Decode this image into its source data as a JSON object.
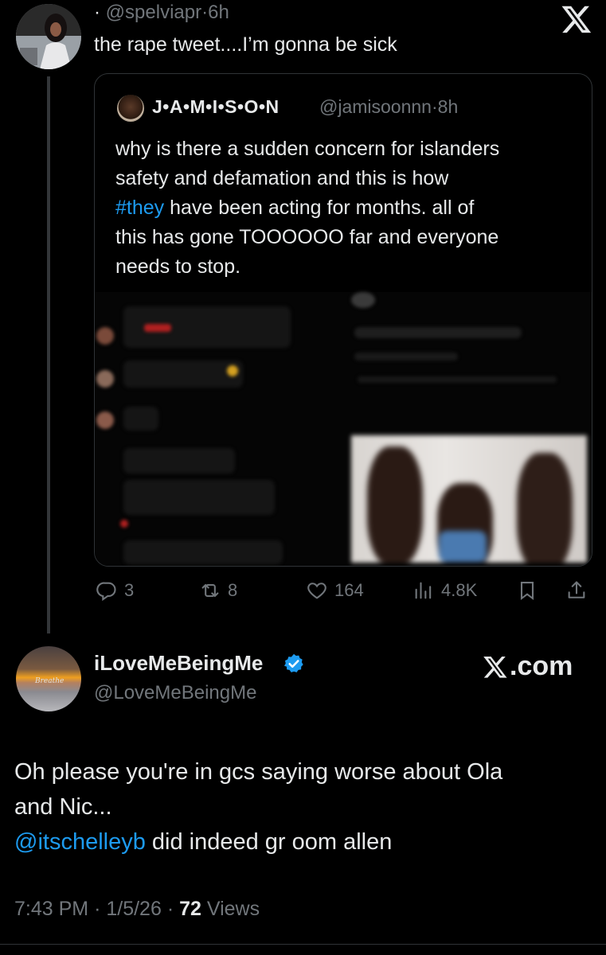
{
  "top_tweet": {
    "dot": "·",
    "handle": "@spelviapr",
    "sep": "·",
    "time": "6h",
    "text": "the rape tweet....I’m gonna be sick",
    "brand_icon": "x-logo-icon"
  },
  "quote": {
    "name": "J•A•M•I•S•O•N",
    "handle": "@jamisoonnn",
    "sep": "·",
    "time": "8h",
    "body_line1": "why is there a sudden concern for islanders",
    "body_line2": "safety and defamation and this is how",
    "hashtag": "#they",
    "body_line3_rest": " have been acting for months. all of",
    "body_line4": "this has gone TOOOOOO far and everyone",
    "body_line5": "needs to stop."
  },
  "actions": {
    "replies": "3",
    "reposts": "8",
    "likes": "164",
    "views": "4.8K"
  },
  "reply_tweet": {
    "avatar_text": "Breathe",
    "name": "iLoveMeBeingMe",
    "handle": "@LoveMeBeingMe",
    "brand": ".com",
    "line1": "Oh please you're in gcs saying worse about Ola",
    "line2": "and Nic...",
    "mention": "@itschelleyb",
    "line3_rest": " did indeed gr oom allen",
    "time": "7:43 PM",
    "sep1": "·",
    "date": "1/5/26",
    "sep2": "·",
    "views_count": "72",
    "views_label": "Views"
  },
  "colors": {
    "background": "#000000",
    "text": "#e7e9ea",
    "muted": "#71767b",
    "link": "#1d9bf0",
    "verified": "#1d9bf0"
  }
}
